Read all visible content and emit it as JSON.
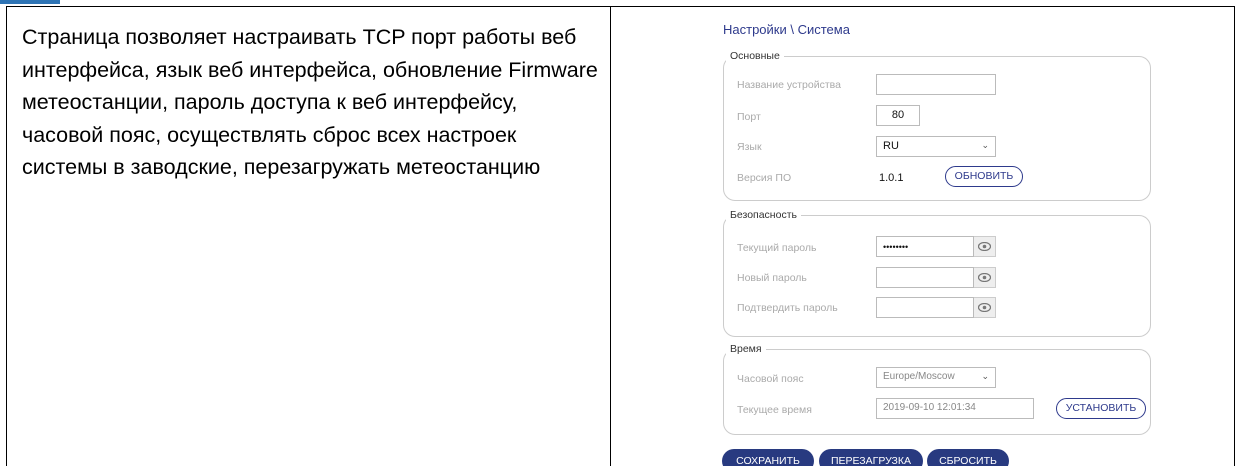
{
  "document": {
    "description": "Страница позволяет настраивать TCP порт работы веб интерфейса, язык веб интерфейса, обновление Firmware метеостанции, пароль доступа к веб интерфейсу, часовой пояс, осуществлять сброс всех настроек системы в заводские, перезагружать метеостанцию"
  },
  "settings": {
    "breadcrumb": "Настройки \\ Система",
    "general": {
      "legend": "Основные",
      "device_name_label": "Название устройства",
      "device_name_value": "",
      "port_label": "Порт",
      "port_value": "80",
      "language_label": "Язык",
      "language_value": "RU",
      "version_label": "Версия ПО",
      "version_value": "1.0.1",
      "update_button": "ОБНОВИТЬ"
    },
    "security": {
      "legend": "Безопасность",
      "current_password_label": "Текущий пароль",
      "current_password_value": "••••••••",
      "new_password_label": "Новый пароль",
      "confirm_password_label": "Подтвердить пароль"
    },
    "time": {
      "legend": "Время",
      "timezone_label": "Часовой пояс",
      "timezone_value": "Europe/Moscow",
      "current_time_label": "Текущее время",
      "current_time_value": "2019-09-10 12:01:34",
      "set_button": "УСТАНОВИТЬ"
    },
    "actions": {
      "save": "СОХРАНИТЬ",
      "reboot": "ПЕРЕЗАГРУЗКА",
      "reset": "СБРОСИТЬ"
    }
  },
  "colors": {
    "accent": "#283a80",
    "heading_blue": "#2e74b5"
  }
}
